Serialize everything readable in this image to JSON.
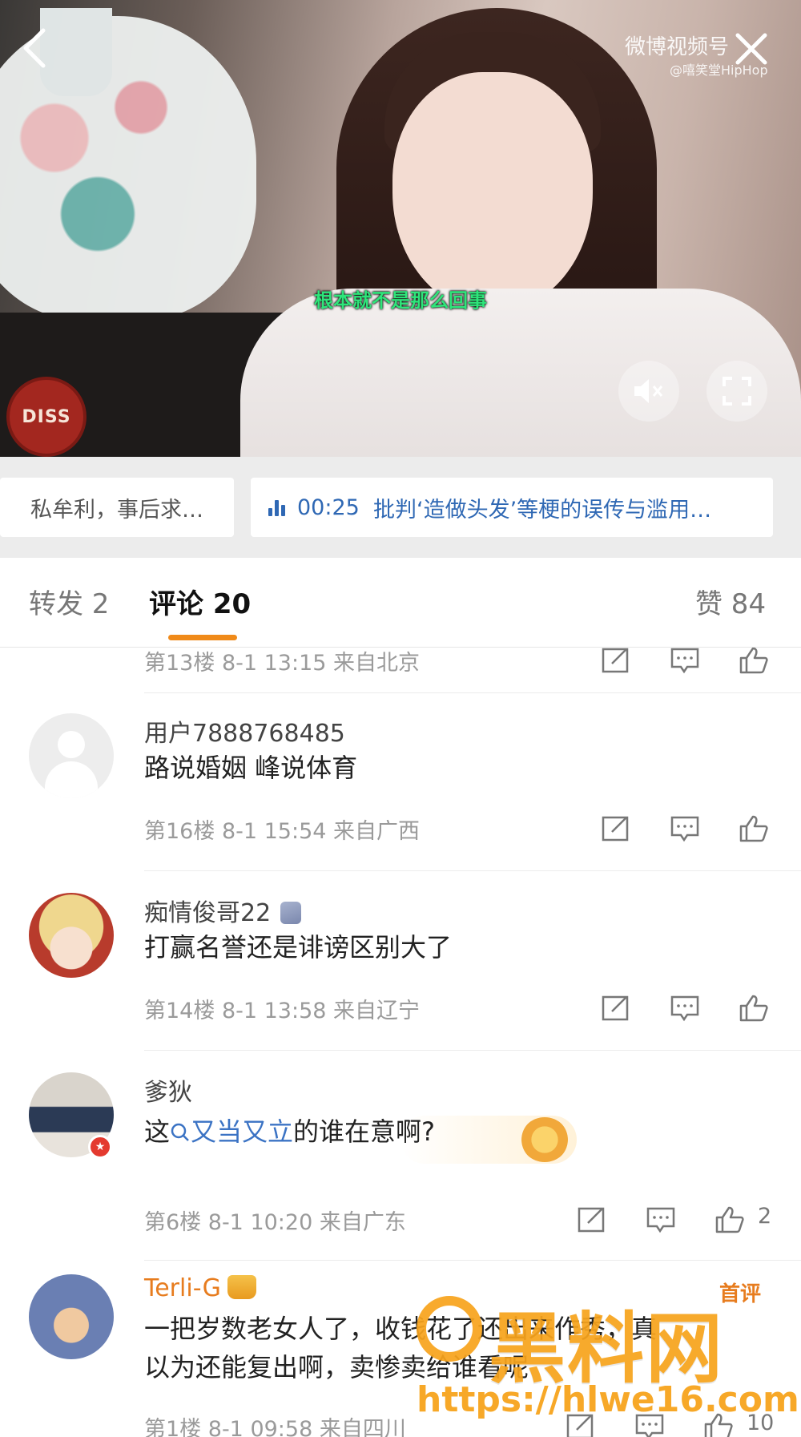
{
  "video": {
    "subtitle": "根本就不是那么回事",
    "watermark_title": "微博视频号",
    "watermark_author": "@嘻笑堂HipHop",
    "badge_text": "DISS",
    "back_icon": "chevron-left-icon",
    "close_icon": "close-icon",
    "mute_icon": "speaker-muted-icon",
    "fullscreen_icon": "fullscreen-icon"
  },
  "chapters": [
    {
      "text": "私牟利，事后求…"
    },
    {
      "time": "00:25",
      "title": "批判‘造做头发’等梗的误传与滥用…"
    }
  ],
  "tabs": {
    "repost": "转发 2",
    "comments": "评论 20",
    "likes": "赞 84"
  },
  "colors": {
    "accent": "#f08a19",
    "link": "#2f68b4",
    "meta": "#9a9a9a"
  },
  "comments": [
    {
      "meta": "第13楼  8-1 13:15  来自北京"
    },
    {
      "user": "用户7888768485",
      "text": "路说婚姻 峰说体育",
      "meta": "第16楼  8-1 15:54  来自广西"
    },
    {
      "user": "痴情俊哥22",
      "text": "打赢名誉还是诽谤区别大了",
      "meta": "第14楼  8-1 13:58  来自辽宁"
    },
    {
      "user": "爹狄",
      "text_before": "这",
      "topic": "又当又立",
      "text_after": "的谁在意啊?",
      "meta": "第6楼  8-1 10:20  来自广东",
      "likes": "2"
    },
    {
      "user": "Terli-G",
      "tag": "首评",
      "line1": "一把岁数老女人了，收钱花了还出来作秀，真",
      "line2": "以为还能复出啊，卖惨卖给谁看呢",
      "meta": "第1楼  8-1 09:58  来自四川",
      "likes": "10"
    }
  ],
  "site_watermark": {
    "main": "黑料网",
    "url": "https://hlwe16.com"
  }
}
